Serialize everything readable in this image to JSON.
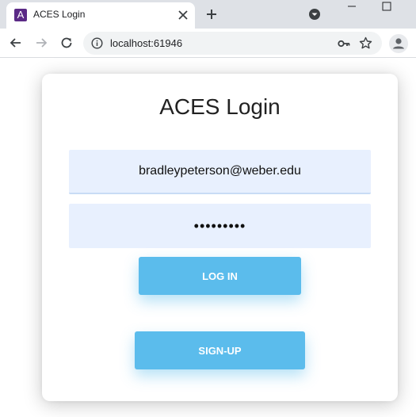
{
  "browser": {
    "tab_title": "ACES Login",
    "favicon_letter": "A",
    "url": "localhost:61946"
  },
  "page": {
    "title": "ACES Login",
    "email_value": "bradleypeterson@weber.edu",
    "password_value": "•••••••••",
    "login_label": "LOG IN",
    "signup_label": "SIGN-UP"
  },
  "colors": {
    "button": "#5bbcec",
    "input_bg": "#e8f0fe",
    "favicon": "#5b2a86"
  }
}
